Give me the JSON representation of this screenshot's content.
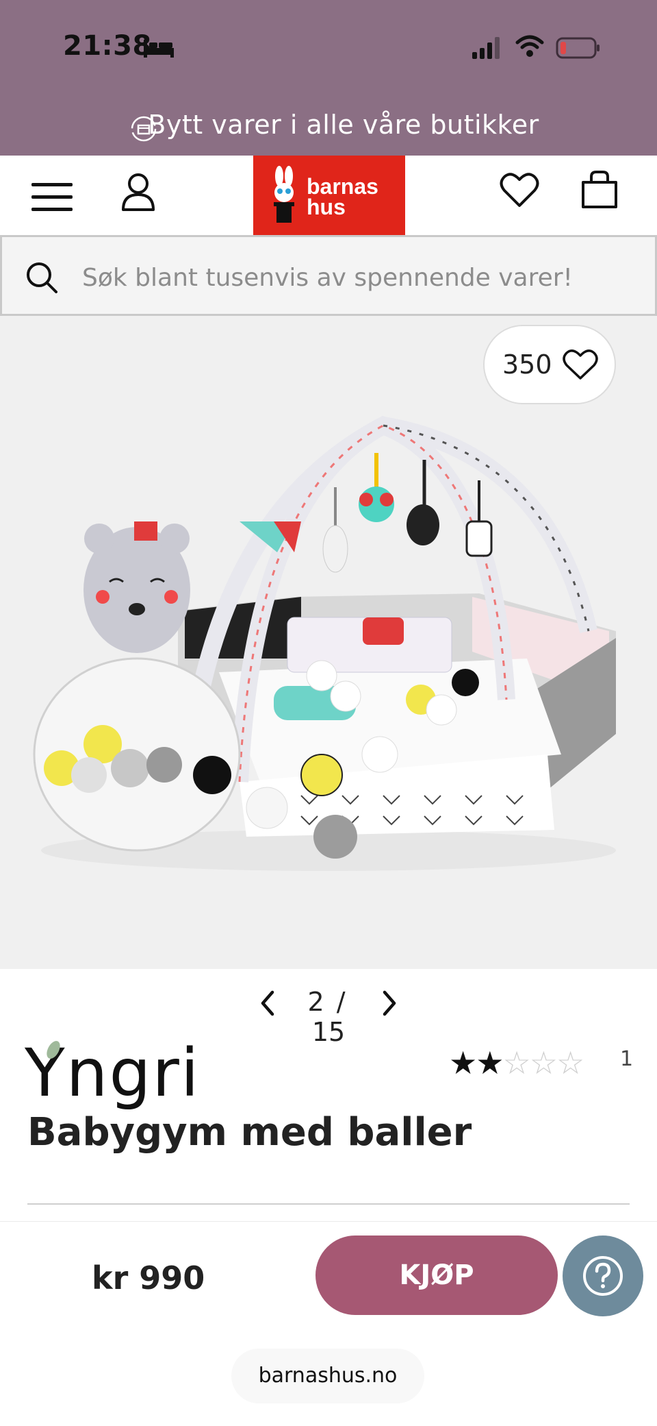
{
  "status_bar": {
    "time": "21:38",
    "icons": [
      "bed-icon",
      "signal-icon",
      "wifi-icon",
      "battery-icon"
    ],
    "battery_color": "#e04848"
  },
  "promo": {
    "text": "Bytt varer i alle våre butikker",
    "icon": "exchange-box-icon",
    "background": "#8b6f84"
  },
  "header": {
    "logo_line1": "barnas",
    "logo_line2": "hus",
    "logo_color": "#e0251a",
    "icons": [
      "menu-icon",
      "user-icon",
      "heart-icon",
      "bag-icon"
    ]
  },
  "search": {
    "placeholder": "Søk blant tusenvis av spennende varer!"
  },
  "gallery": {
    "favorites_count": "350",
    "current": "2",
    "separator": "/",
    "total": "15"
  },
  "product": {
    "brand": "Yngri",
    "rating": 2,
    "rating_max": 5,
    "rating_count": "1",
    "title": "Babygym med baller"
  },
  "buy": {
    "price": "kr 990",
    "button_label": "KJØP",
    "button_color": "#a65873",
    "help_color": "#6e8b9c"
  },
  "browser": {
    "url": "barnashus.no"
  }
}
